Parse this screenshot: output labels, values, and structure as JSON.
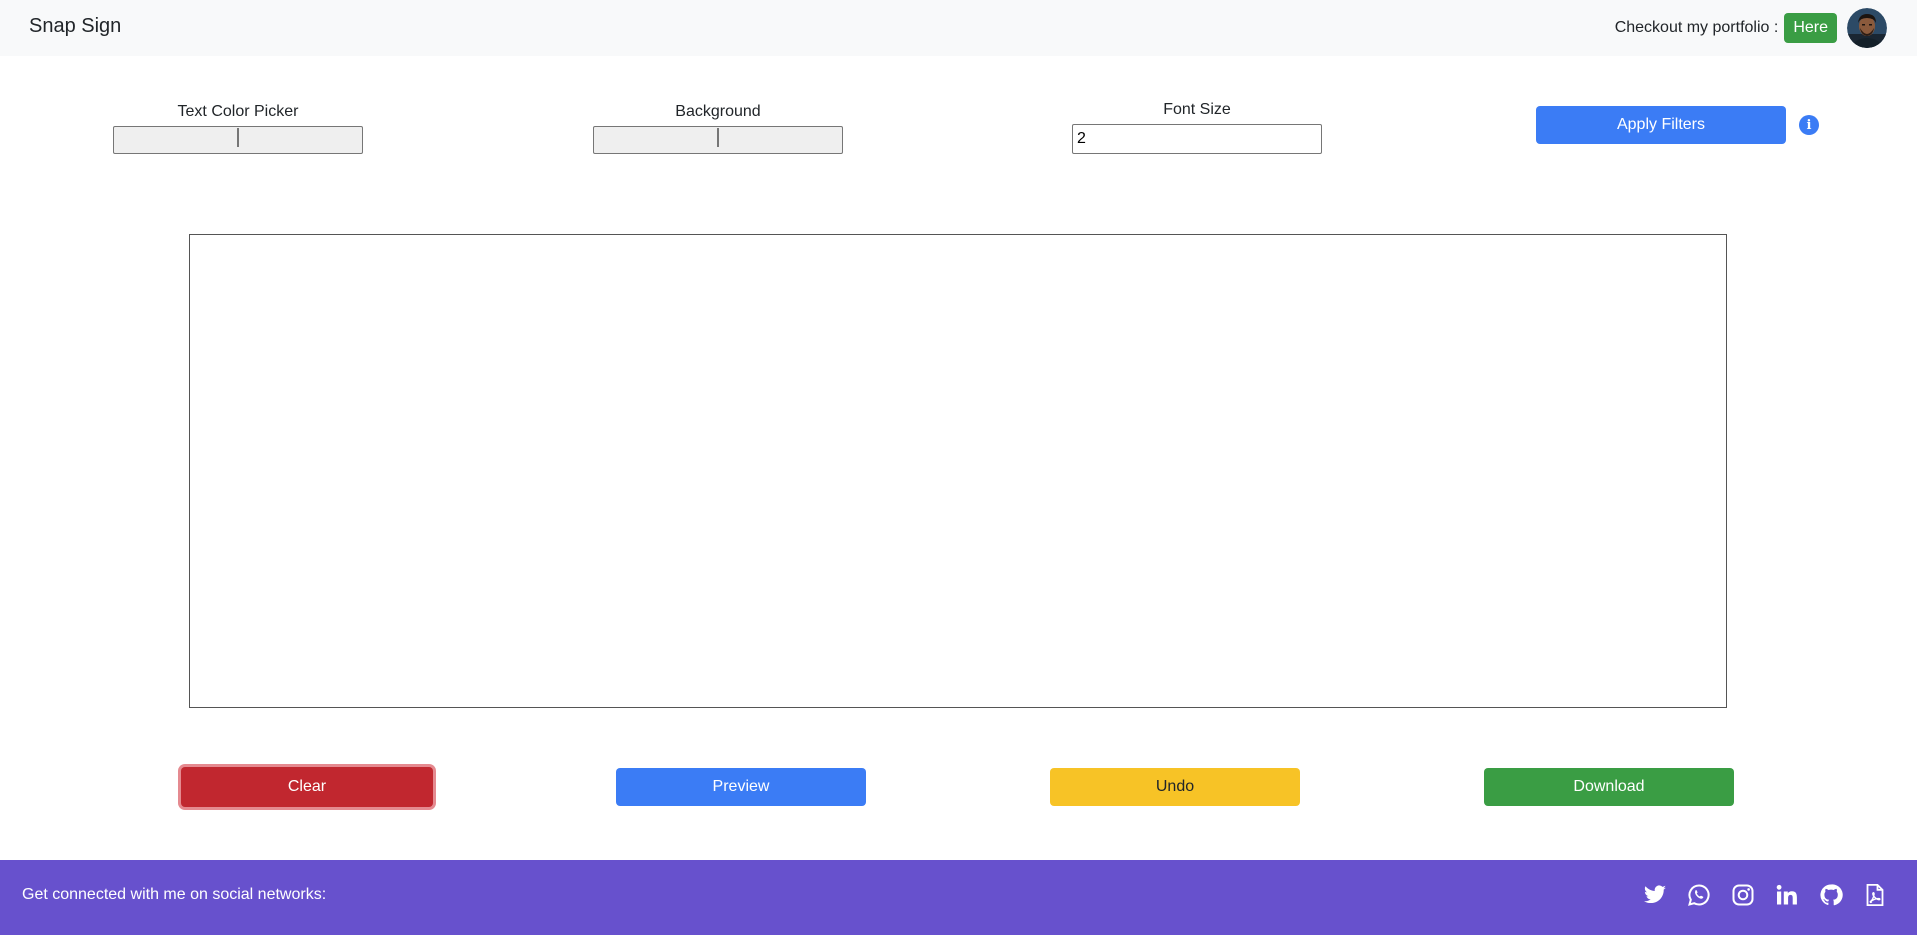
{
  "navbar": {
    "brand": "Snap Sign",
    "portfolio_text": "Checkout my portfolio :",
    "here_label": "Here"
  },
  "filters": {
    "text_color": {
      "label": "Text Color Picker",
      "value": "#000000"
    },
    "background": {
      "label": "Background",
      "value": "#000000"
    },
    "font_size": {
      "label": "Font Size",
      "value": "2"
    },
    "apply_label": "Apply Filters"
  },
  "actions": {
    "clear_label": "Clear",
    "preview_label": "Preview",
    "undo_label": "Undo",
    "download_label": "Download"
  },
  "footer": {
    "text": "Get connected with me on social networks:",
    "icons": [
      "twitter-icon",
      "whatsapp-icon",
      "instagram-icon",
      "linkedin-icon",
      "github-icon",
      "pdf-file-icon"
    ]
  },
  "colors": {
    "primary": "#3b7cf5",
    "success": "#3a9d44",
    "danger": "#c1272f",
    "warning": "#f7c326",
    "footer": "#6751cd",
    "navbar": "#f8f9fa"
  }
}
